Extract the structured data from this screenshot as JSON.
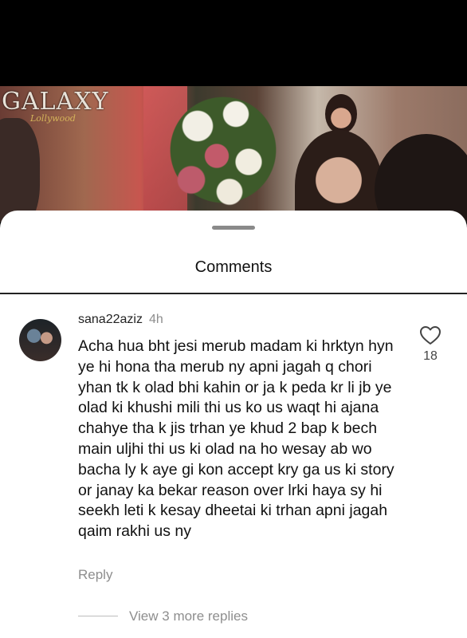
{
  "video": {
    "logo_text": "GALAXY",
    "logo_subtext": "Lollywood"
  },
  "sheet": {
    "title": "Comments"
  },
  "comment": {
    "username": "sana22aziz",
    "time": "4h",
    "text": "Acha hua bht jesi merub madam ki hrktyn hyn ye hi hona tha merub ny apni jagah q chori yhan tk k olad bhi kahin or ja k peda kr li jb ye olad ki khushi mili thi us ko us waqt hi ajana chahye tha k jis trhan ye khud 2 bap k bech main uljhi thi us ki olad na ho wesay ab wo bacha ly k aye gi kon accept kry ga us ki story or janay ka bekar reason over lrki haya sy hi seekh leti k kesay dheetai ki trhan apni jagah qaim rakhi us ny",
    "like_count": "18",
    "reply_label": "Reply",
    "view_replies_label": "View 3 more replies",
    "icons": {
      "like": "heart-outline-icon"
    }
  }
}
